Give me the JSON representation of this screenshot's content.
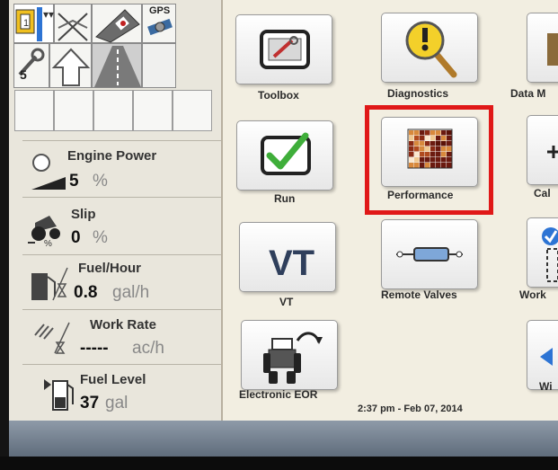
{
  "status_bar": {
    "gps_label": "GPS",
    "tool_count": "5"
  },
  "indicators": {
    "engine_power": {
      "label": "Engine Power",
      "value": "5",
      "unit": "%"
    },
    "slip": {
      "label": "Slip",
      "value": "0",
      "unit": "%"
    },
    "fuel_hour": {
      "label": "Fuel/Hour",
      "value": "0.8",
      "unit": "gal/h"
    },
    "work_rate": {
      "label": "Work Rate",
      "value": "-----",
      "unit": "ac/h"
    },
    "fuel_level": {
      "label": "Fuel Level",
      "value": "37",
      "unit": "gal"
    }
  },
  "apps": {
    "toolbox": "Toolbox",
    "diagnostics": "Diagnostics",
    "data_m": "Data M",
    "run": "Run",
    "performance": "Performance",
    "cal": "Cal",
    "vt": "VT",
    "vt_icon_text": "VT",
    "remote_valves": "Remote Valves",
    "work": "Work",
    "electronic_eor": "Electronic EOR",
    "wi": "Wi"
  },
  "timestamp": "2:37 pm - Feb 07, 2014",
  "colors": {
    "highlight": "#e01818",
    "check_green": "#3fae3a",
    "warning_yellow": "#f3d02a",
    "vt_blue": "#2f3f5c"
  }
}
